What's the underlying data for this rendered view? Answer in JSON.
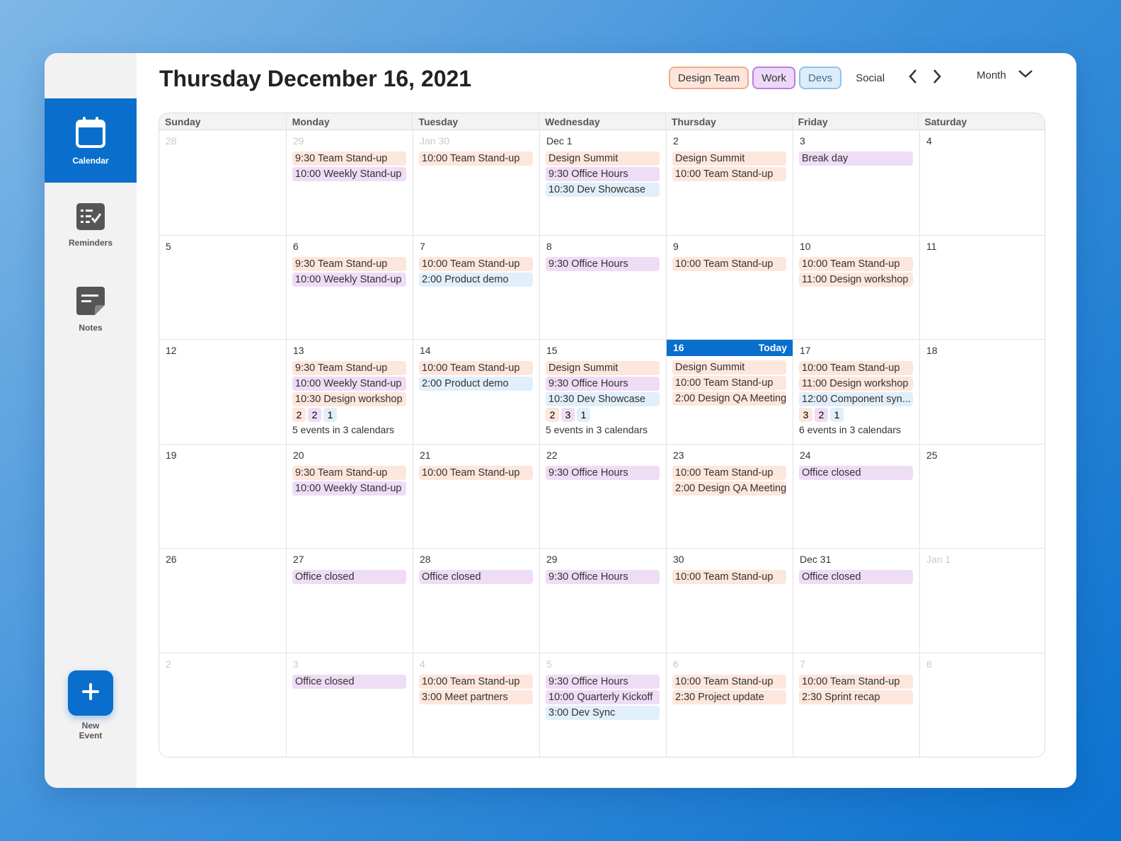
{
  "sidebar": {
    "items": [
      {
        "label": "Calendar",
        "active": true,
        "icon": "calendar-icon"
      },
      {
        "label": "Reminders",
        "active": false,
        "icon": "checklist-icon"
      },
      {
        "label": "Notes",
        "active": false,
        "icon": "note-icon"
      }
    ],
    "new_event": {
      "label": "New\nEvent",
      "icon": "plus-icon"
    }
  },
  "header": {
    "title": "Thursday December 16, 2021",
    "filters": [
      {
        "label": "Design Team",
        "cal": "design"
      },
      {
        "label": "Work",
        "cal": "work"
      },
      {
        "label": "Devs",
        "cal": "devs"
      },
      {
        "label": "Social",
        "cal": "social"
      }
    ],
    "prev_icon": "chevron-left-icon",
    "next_icon": "chevron-right-icon",
    "view": "Month",
    "view_icon": "chevron-down-icon"
  },
  "colors": {
    "accent": "#0a6fcc",
    "design": "#fde6dc",
    "work": "#efdcf5",
    "devs": "#e1effa"
  },
  "calendar": {
    "weekdays": [
      "Sunday",
      "Monday",
      "Tuesday",
      "Wednesday",
      "Thursday",
      "Friday",
      "Saturday"
    ],
    "weeks": [
      [
        {
          "day": "28",
          "dim": true,
          "events": []
        },
        {
          "day": "29",
          "dim": true,
          "events": [
            {
              "text": "9:30 Team Stand-up",
              "cal": "design"
            },
            {
              "text": "10:00 Weekly Stand-up",
              "cal": "work"
            }
          ]
        },
        {
          "day": "Jan 30",
          "dim": true,
          "events": [
            {
              "text": "10:00 Team Stand-up",
              "cal": "design"
            }
          ]
        },
        {
          "day": "Dec 1",
          "events": [
            {
              "text": "Design Summit",
              "cal": "design"
            },
            {
              "text": "9:30 Office Hours",
              "cal": "work"
            },
            {
              "text": "10:30 Dev Showcase",
              "cal": "devs"
            }
          ]
        },
        {
          "day": "2",
          "events": [
            {
              "text": "Design Summit",
              "cal": "design"
            },
            {
              "text": "10:00 Team Stand-up",
              "cal": "design"
            }
          ]
        },
        {
          "day": "3",
          "events": [
            {
              "text": "Break day",
              "cal": "work"
            }
          ]
        },
        {
          "day": "4",
          "events": []
        }
      ],
      [
        {
          "day": "5",
          "events": []
        },
        {
          "day": "6",
          "events": [
            {
              "text": "9:30 Team Stand-up",
              "cal": "design"
            },
            {
              "text": "10:00 Weekly Stand-up",
              "cal": "work"
            }
          ]
        },
        {
          "day": "7",
          "events": [
            {
              "text": "10:00 Team Stand-up",
              "cal": "design"
            },
            {
              "text": "2:00 Product demo",
              "cal": "devs"
            }
          ]
        },
        {
          "day": "8",
          "events": [
            {
              "text": "9:30 Office Hours",
              "cal": "work"
            }
          ]
        },
        {
          "day": "9",
          "events": [
            {
              "text": "10:00 Team Stand-up",
              "cal": "design"
            }
          ]
        },
        {
          "day": "10",
          "events": [
            {
              "text": "10:00 Team Stand-up",
              "cal": "design"
            },
            {
              "text": "11:00 Design workshop",
              "cal": "design"
            }
          ]
        },
        {
          "day": "11",
          "events": []
        }
      ],
      [
        {
          "day": "12",
          "events": []
        },
        {
          "day": "13",
          "events": [
            {
              "text": "9:30 Team Stand-up",
              "cal": "design"
            },
            {
              "text": "10:00 Weekly Stand-up",
              "cal": "work"
            },
            {
              "text": "10:30 Design workshop",
              "cal": "design"
            }
          ],
          "counts": [
            {
              "n": "2",
              "cal": "design"
            },
            {
              "n": "2",
              "cal": "work"
            },
            {
              "n": "1",
              "cal": "devs"
            }
          ],
          "summary": "5 events in 3 calendars"
        },
        {
          "day": "14",
          "events": [
            {
              "text": "10:00 Team Stand-up",
              "cal": "design"
            },
            {
              "text": "2:00 Product demo",
              "cal": "devs"
            }
          ]
        },
        {
          "day": "15",
          "events": [
            {
              "text": "Design Summit",
              "cal": "design"
            },
            {
              "text": "9:30 Office Hours",
              "cal": "work"
            },
            {
              "text": "10:30 Dev Showcase",
              "cal": "devs"
            }
          ],
          "counts": [
            {
              "n": "2",
              "cal": "design"
            },
            {
              "n": "3",
              "cal": "work"
            },
            {
              "n": "1",
              "cal": "devs"
            }
          ],
          "summary": "5 events in 3 calendars"
        },
        {
          "day": "16",
          "today": true,
          "today_label": "Today",
          "events": [
            {
              "text": "Design Summit",
              "cal": "design"
            },
            {
              "text": "10:00 Team Stand-up",
              "cal": "design"
            },
            {
              "text": "2:00 Design QA Meeting",
              "cal": "design"
            }
          ]
        },
        {
          "day": "17",
          "events": [
            {
              "text": "10:00 Team Stand-up",
              "cal": "design"
            },
            {
              "text": "11:00 Design workshop",
              "cal": "design"
            },
            {
              "text": "12:00 Component syn...",
              "cal": "devs"
            }
          ],
          "counts": [
            {
              "n": "3",
              "cal": "design"
            },
            {
              "n": "2",
              "cal": "work"
            },
            {
              "n": "1",
              "cal": "devs"
            }
          ],
          "summary": "6 events in 3 calendars"
        },
        {
          "day": "18",
          "events": []
        }
      ],
      [
        {
          "day": "19",
          "events": []
        },
        {
          "day": "20",
          "events": [
            {
              "text": "9:30 Team Stand-up",
              "cal": "design"
            },
            {
              "text": "10:00 Weekly Stand-up",
              "cal": "work"
            }
          ]
        },
        {
          "day": "21",
          "events": [
            {
              "text": "10:00 Team Stand-up",
              "cal": "design"
            }
          ]
        },
        {
          "day": "22",
          "events": [
            {
              "text": "9:30 Office Hours",
              "cal": "work"
            }
          ]
        },
        {
          "day": "23",
          "events": [
            {
              "text": "10:00 Team Stand-up",
              "cal": "design"
            },
            {
              "text": "2:00 Design QA Meeting",
              "cal": "design"
            }
          ]
        },
        {
          "day": "24",
          "events": [
            {
              "text": "Office closed",
              "cal": "work"
            }
          ]
        },
        {
          "day": "25",
          "events": []
        }
      ],
      [
        {
          "day": "26",
          "events": []
        },
        {
          "day": "27",
          "events": [
            {
              "text": "Office closed",
              "cal": "work"
            }
          ]
        },
        {
          "day": "28",
          "events": [
            {
              "text": "Office closed",
              "cal": "work"
            }
          ]
        },
        {
          "day": "29",
          "events": [
            {
              "text": "9:30 Office Hours",
              "cal": "work"
            }
          ]
        },
        {
          "day": "30",
          "events": [
            {
              "text": "10:00 Team Stand-up",
              "cal": "design"
            }
          ]
        },
        {
          "day": "Dec 31",
          "events": [
            {
              "text": "Office closed",
              "cal": "work"
            }
          ]
        },
        {
          "day": "Jan 1",
          "dim": true,
          "events": []
        }
      ],
      [
        {
          "day": "2",
          "dim": true,
          "events": []
        },
        {
          "day": "3",
          "dim": true,
          "events": [
            {
              "text": "Office closed",
              "cal": "work"
            }
          ]
        },
        {
          "day": "4",
          "dim": true,
          "events": [
            {
              "text": "10:00 Team Stand-up",
              "cal": "design"
            },
            {
              "text": "3:00 Meet partners",
              "cal": "design"
            }
          ]
        },
        {
          "day": "5",
          "dim": true,
          "events": [
            {
              "text": "9:30 Office Hours",
              "cal": "work"
            },
            {
              "text": "10:00 Quarterly Kickoff",
              "cal": "work"
            },
            {
              "text": "3:00 Dev Sync",
              "cal": "devs"
            }
          ]
        },
        {
          "day": "6",
          "dim": true,
          "events": [
            {
              "text": "10:00 Team Stand-up",
              "cal": "design"
            },
            {
              "text": "2:30 Project update",
              "cal": "design"
            }
          ]
        },
        {
          "day": "7",
          "dim": true,
          "events": [
            {
              "text": "10:00 Team Stand-up",
              "cal": "design"
            },
            {
              "text": "2:30 Sprint recap",
              "cal": "design"
            }
          ]
        },
        {
          "day": "8",
          "dim": true,
          "events": []
        }
      ]
    ]
  }
}
